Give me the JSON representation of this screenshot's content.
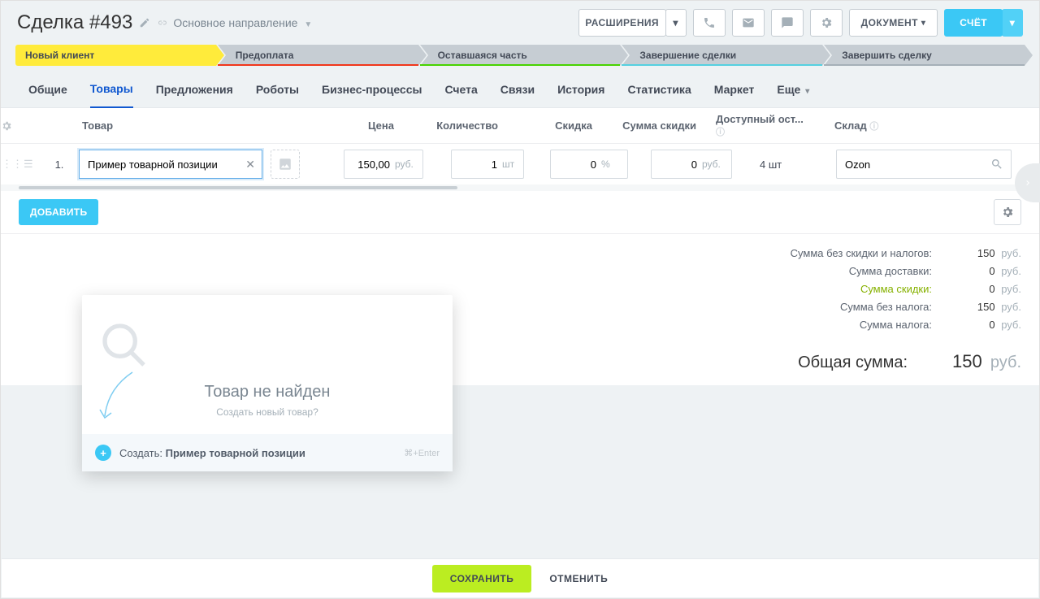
{
  "header": {
    "title_prefix": "Сделка",
    "title_number": "#493",
    "breadcrumb": "Основное направление",
    "extensions": "РАСШИРЕНИЯ",
    "document": "ДОКУМЕНТ",
    "invoice": "СЧЁТ"
  },
  "stages": [
    {
      "label": "Новый клиент",
      "active": true,
      "underline": ""
    },
    {
      "label": "Предоплата",
      "active": false,
      "underline": "u-red"
    },
    {
      "label": "Оставшаяся часть",
      "active": false,
      "underline": "u-green"
    },
    {
      "label": "Завершение сделки",
      "active": false,
      "underline": "u-blue"
    },
    {
      "label": "Завершить сделку",
      "active": false,
      "underline": "u-gray"
    }
  ],
  "tabs": [
    "Общие",
    "Товары",
    "Предложения",
    "Роботы",
    "Бизнес-процессы",
    "Счета",
    "Связи",
    "История",
    "Статистика",
    "Маркет"
  ],
  "tabs_more": "Еще",
  "tabs_active_index": 1,
  "table": {
    "headers": {
      "product": "Товар",
      "price": "Цена",
      "qty": "Количество",
      "discount": "Скидка",
      "discount_sum": "Сумма скидки",
      "avail": "Доступный ост...",
      "store": "Склад"
    },
    "row": {
      "num": "1.",
      "product_value": "Пример товарной позиции",
      "price": "150,00",
      "price_cur": "руб.",
      "qty": "1",
      "qty_unit": "шт",
      "discount": "0",
      "discount_unit": "%",
      "discount_sum": "0",
      "discount_sum_cur": "руб.",
      "avail": "4 шт",
      "store": "Ozon"
    },
    "add_button": "ДОБАВИТЬ"
  },
  "dropdown": {
    "not_found": "Товар не найден",
    "create_prompt": "Создать новый товар?",
    "create_action": "Создать:",
    "create_name": "Пример товарной позиции",
    "shortcut": "⌘+Enter"
  },
  "totals": {
    "rows": [
      {
        "label": "Сумма без скидки и налогов:",
        "value": "150",
        "cur": "руб.",
        "green": false
      },
      {
        "label": "Сумма доставки:",
        "value": "0",
        "cur": "руб.",
        "green": false
      },
      {
        "label": "Сумма скидки:",
        "value": "0",
        "cur": "руб.",
        "green": true
      },
      {
        "label": "Сумма без налога:",
        "value": "150",
        "cur": "руб.",
        "green": false
      },
      {
        "label": "Сумма налога:",
        "value": "0",
        "cur": "руб.",
        "green": false
      }
    ],
    "grand_label": "Общая сумма:",
    "grand_value": "150",
    "grand_cur": "руб."
  },
  "footer": {
    "save": "СОХРАНИТЬ",
    "cancel": "ОТМЕНИТЬ"
  }
}
